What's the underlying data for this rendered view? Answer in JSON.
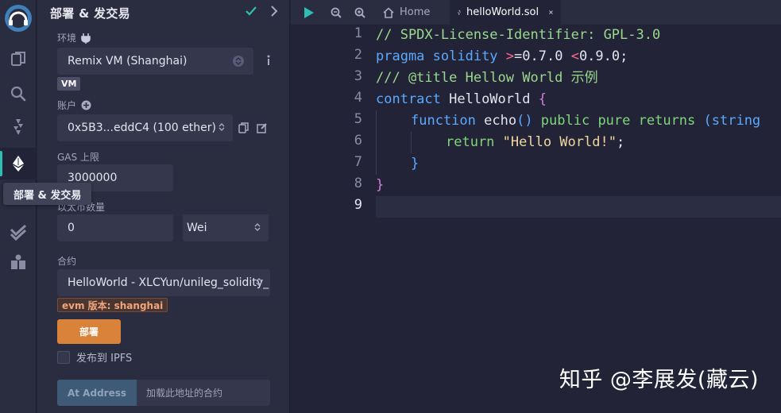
{
  "sidebar_panel": {
    "title": "部署 & 发交易",
    "environment_label": "环境",
    "environment_value": "Remix VM (Shanghai)",
    "vm_badge": "VM",
    "account_label": "账户",
    "account_value": "0x5B3...eddC4 (100 ether)",
    "gas_label": "GAS 上限",
    "gas_value": "3000000",
    "value_label": "以太币数量",
    "value_amount": "0",
    "value_unit": "Wei",
    "contract_label": "合约",
    "contract_value": "HelloWorld - XLCYun/unileg_solidity_",
    "evm_badge": "evm 版本: shanghai",
    "deploy_label": "部署",
    "ipfs_label": "发布到 IPFS",
    "at_address_label": "At Address",
    "at_address_placeholder": "加载此地址的合约"
  },
  "tooltip": "部署 & 发交易",
  "tabs": [
    {
      "label": "Home"
    },
    {
      "label": "helloWorld.sol"
    }
  ],
  "editor": {
    "line_numbers": [
      "1",
      "2",
      "3",
      "4",
      "5",
      "6",
      "7",
      "8",
      "9"
    ],
    "lines": {
      "l1": "// SPDX-License-Identifier: GPL-3.0",
      "l2_kw": "pragma",
      "l2_name": " solidity ",
      "l2_op1": ">",
      "l2_v1": "=0.7.0 ",
      "l2_op2": "<",
      "l2_v2": "0.9.0;",
      "l3": "/// @title Hellow World 示例",
      "l4_kw": "contract",
      "l4_name": " HelloWorld ",
      "l4_brace": "{",
      "l5_kw": "function",
      "l5_name": " echo",
      "l5_paren": "()",
      "l5_mods": " public pure ",
      "l5_ret": "returns",
      "l5_rest": " (string",
      "l6_kw": "return",
      "l6_str": " \"Hello World!\"",
      "l6_end": ";",
      "l7": "}",
      "l8": "}"
    }
  },
  "watermark": "知乎 @李展发(藏云)",
  "colors": {
    "accent": "#2fbfb1",
    "deploy": "#d8823a",
    "check": "#2fbfb1"
  }
}
